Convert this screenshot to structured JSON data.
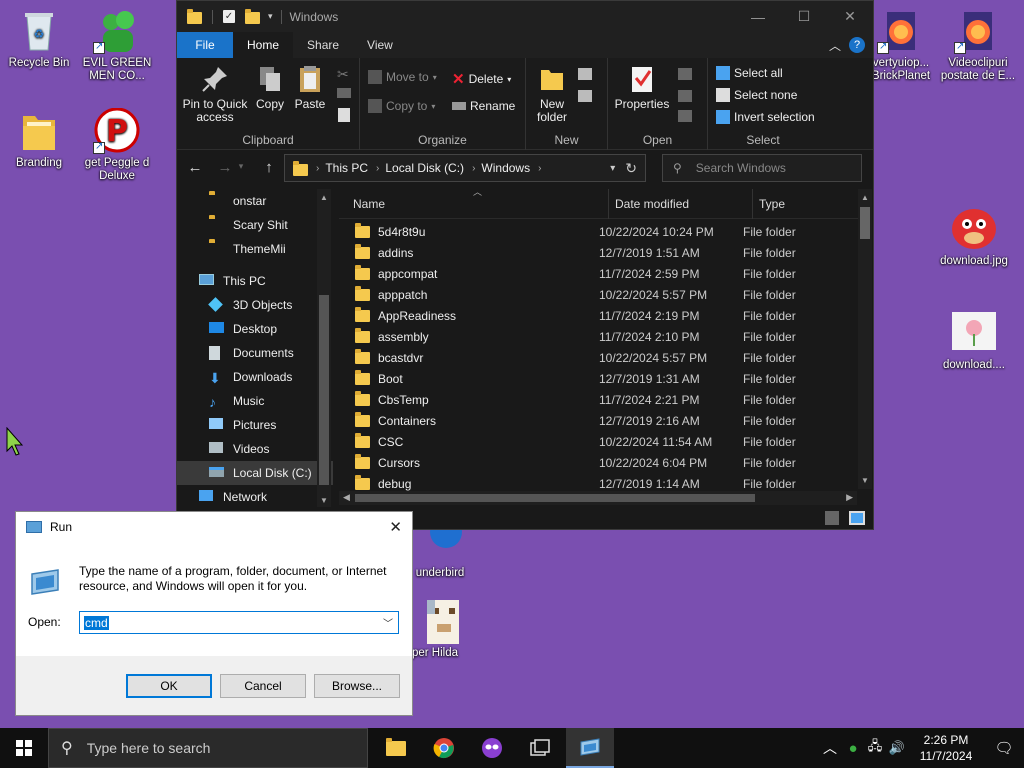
{
  "desktop": {
    "icons": [
      {
        "label": "Recycle Bin"
      },
      {
        "label": "EVIL GREEN MEN CO..."
      },
      {
        "label": "Branding"
      },
      {
        "label": "get Peggle d Deluxe"
      },
      {
        "label": "vertyuiop... BrickPlanet"
      },
      {
        "label": "Videoclipuri postate de E..."
      },
      {
        "label": "download.jpg"
      },
      {
        "label": "download...."
      },
      {
        "label": "underbird"
      },
      {
        "label": "per Hilda"
      }
    ]
  },
  "explorer": {
    "title": "Windows",
    "tabs": {
      "file": "File",
      "home": "Home",
      "share": "Share",
      "view": "View"
    },
    "ribbon": {
      "clipboard": {
        "label": "Clipboard",
        "pin": "Pin to Quick access",
        "copy": "Copy",
        "paste": "Paste"
      },
      "organize": {
        "label": "Organize",
        "move_to": "Move to",
        "copy_to": "Copy to",
        "delete": "Delete",
        "rename": "Rename"
      },
      "new": {
        "label": "New",
        "new_folder": "New folder"
      },
      "open": {
        "label": "Open",
        "properties": "Properties"
      },
      "select": {
        "label": "Select",
        "select_all": "Select all",
        "select_none": "Select none",
        "invert": "Invert selection"
      }
    },
    "address": {
      "this_pc": "This PC",
      "disk": "Local Disk (C:)",
      "folder": "Windows"
    },
    "search_placeholder": "Search Windows",
    "nav": [
      {
        "label": "onstar",
        "icon": "folder"
      },
      {
        "label": "Scary Shit",
        "icon": "folder"
      },
      {
        "label": "ThemeMii",
        "icon": "folder"
      },
      {
        "label": "This PC",
        "icon": "pc"
      },
      {
        "label": "3D Objects",
        "icon": "3d"
      },
      {
        "label": "Desktop",
        "icon": "desktop"
      },
      {
        "label": "Documents",
        "icon": "documents"
      },
      {
        "label": "Downloads",
        "icon": "downloads"
      },
      {
        "label": "Music",
        "icon": "music"
      },
      {
        "label": "Pictures",
        "icon": "pictures"
      },
      {
        "label": "Videos",
        "icon": "videos"
      },
      {
        "label": "Local Disk (C:)",
        "icon": "disk"
      },
      {
        "label": "Network",
        "icon": "network"
      }
    ],
    "columns": {
      "name": "Name",
      "date": "Date modified",
      "type": "Type"
    },
    "files": [
      {
        "name": "5d4r8t9u",
        "date": "10/22/2024 10:24 PM",
        "type": "File folder"
      },
      {
        "name": "addins",
        "date": "12/7/2019 1:51 AM",
        "type": "File folder"
      },
      {
        "name": "appcompat",
        "date": "11/7/2024 2:59 PM",
        "type": "File folder"
      },
      {
        "name": "apppatch",
        "date": "10/22/2024 5:57 PM",
        "type": "File folder"
      },
      {
        "name": "AppReadiness",
        "date": "11/7/2024 2:19 PM",
        "type": "File folder"
      },
      {
        "name": "assembly",
        "date": "11/7/2024 2:10 PM",
        "type": "File folder"
      },
      {
        "name": "bcastdvr",
        "date": "10/22/2024 5:57 PM",
        "type": "File folder"
      },
      {
        "name": "Boot",
        "date": "12/7/2019 1:31 AM",
        "type": "File folder"
      },
      {
        "name": "CbsTemp",
        "date": "11/7/2024 2:21 PM",
        "type": "File folder"
      },
      {
        "name": "Containers",
        "date": "12/7/2019 2:16 AM",
        "type": "File folder"
      },
      {
        "name": "CSC",
        "date": "10/22/2024 11:54 AM",
        "type": "File folder"
      },
      {
        "name": "Cursors",
        "date": "10/22/2024 6:04 PM",
        "type": "File folder"
      },
      {
        "name": "debug",
        "date": "12/7/2019 1:14 AM",
        "type": "File folder"
      }
    ]
  },
  "run": {
    "title": "Run",
    "description": "Type the name of a program, folder, document, or Internet resource, and Windows will open it for you.",
    "open_label": "Open:",
    "value": "cmd",
    "ok": "OK",
    "cancel": "Cancel",
    "browse": "Browse..."
  },
  "taskbar": {
    "search_placeholder": "Type here to search",
    "time": "2:26 PM",
    "date": "11/7/2024"
  },
  "colors": {
    "accent": "#0078d7",
    "desktop": "#7a4fb0",
    "folder": "#f5c94e"
  }
}
